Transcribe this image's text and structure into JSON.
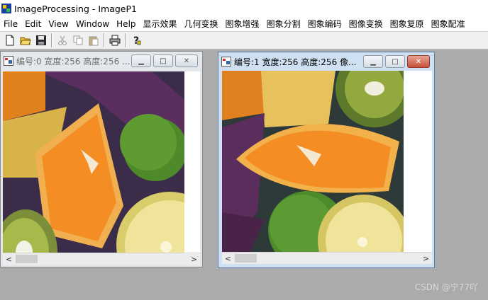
{
  "app": {
    "title": "ImageProcessing - ImageP1"
  },
  "menu": [
    "File",
    "Edit",
    "View",
    "Window",
    "Help",
    "显示效果",
    "几何变换",
    "图象增强",
    "图象分割",
    "图象编码",
    "图像变换",
    "图象复原",
    "图象配准"
  ],
  "toolbar": {
    "buttons": [
      "new-file-icon",
      "open-folder-icon",
      "save-disk-icon",
      "cut-scissors-icon",
      "copy-icon",
      "paste-icon",
      "print-icon",
      "help-question-icon"
    ]
  },
  "windows": [
    {
      "title": "编号:0 宽度:256 高度:256 ...",
      "state": "inactive"
    },
    {
      "title": "编号:1 宽度:256 高度:256 像...",
      "state": "active"
    }
  ],
  "caption_buttons": {
    "minimize": "▁",
    "maximize": "□",
    "close": "✕"
  },
  "scrollbar": {
    "left_arrow": "<",
    "right_arrow": ">"
  },
  "watermark": "CSDN @宁77吖",
  "colors": {
    "active_border": "#5a7ea8",
    "close_red": "#c7503a",
    "mdi_bg": "#ababab"
  }
}
